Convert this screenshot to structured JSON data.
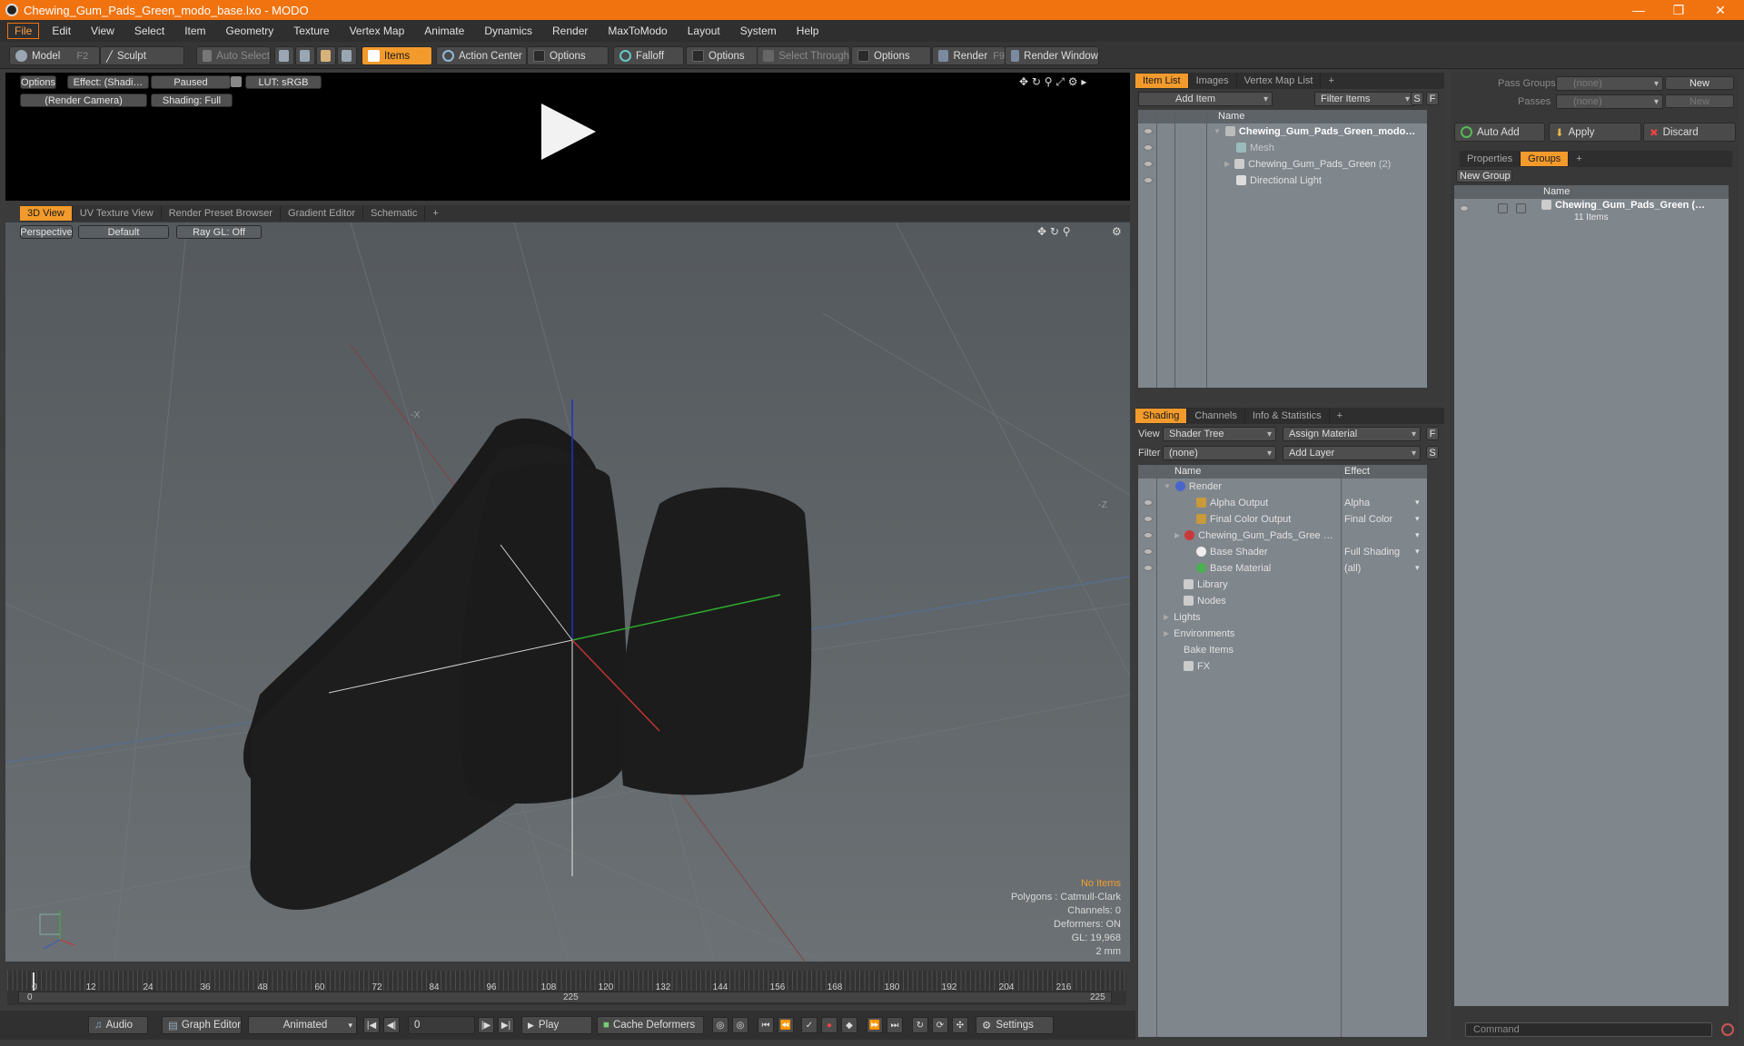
{
  "window": {
    "title": "Chewing_Gum_Pads_Green_modo_base.lxo - MODO"
  },
  "menu": [
    "File",
    "Edit",
    "View",
    "Select",
    "Item",
    "Geometry",
    "Texture",
    "Vertex Map",
    "Animate",
    "Dynamics",
    "Render",
    "MaxToModo",
    "Layout",
    "System",
    "Help"
  ],
  "toolbar": {
    "model": "Model",
    "model_key": "F2",
    "sculpt": "Sculpt",
    "auto_select": "Auto Select",
    "items": "Items",
    "action_center": "Action Center",
    "options1": "Options",
    "falloff": "Falloff",
    "options2": "Options",
    "select_through": "Select Through",
    "options3": "Options",
    "render": "Render",
    "render_key": "F9",
    "render_window": "Render Window"
  },
  "preview": {
    "options": "Options",
    "effect": "Effect: (Shadi…",
    "paused": "Paused",
    "lut": "LUT: sRGB",
    "camera": "(Render Camera)",
    "shading": "Shading: Full"
  },
  "viewport_tabs": [
    "3D View",
    "UV Texture View",
    "Render Preset Browser",
    "Gradient Editor",
    "Schematic"
  ],
  "viewport": {
    "projection": "Perspective",
    "style": "Default",
    "raygl": "Ray GL: Off",
    "axis_neg_x": "-X",
    "axis_neg_z": "-Z",
    "status": [
      "No Items",
      "Polygons : Catmull-Clark",
      "Channels: 0",
      "Deformers: ON",
      "GL: 19,968",
      "2 mm"
    ]
  },
  "timeline": {
    "ticks": [
      "0",
      "12",
      "24",
      "36",
      "48",
      "60",
      "72",
      "84",
      "96",
      "108",
      "120",
      "132",
      "144",
      "156",
      "168",
      "180",
      "192",
      "204",
      "216"
    ],
    "range_start": "0",
    "range_mid": "225",
    "range_end": "225"
  },
  "bottom": {
    "audio": "Audio",
    "graph_editor": "Graph Editor",
    "animated": "Animated",
    "frame": "0",
    "play": "Play",
    "cache_deformers": "Cache Deformers",
    "settings": "Settings",
    "command_placeholder": "Command"
  },
  "item_list": {
    "tabs": [
      "Item List",
      "Images",
      "Vertex Map List"
    ],
    "add_item": "Add Item",
    "filter_items": "Filter Items",
    "s": "S",
    "f": "F",
    "col_name": "Name",
    "rows": [
      {
        "label": "Chewing_Gum_Pads_Green_modo…"
      },
      {
        "label": "Mesh"
      },
      {
        "label": "Chewing_Gum_Pads_Green",
        "count": "(2)"
      },
      {
        "label": "Directional Light"
      }
    ]
  },
  "shading": {
    "tabs": [
      "Shading",
      "Channels",
      "Info & Statistics"
    ],
    "view_label": "View",
    "view_value": "Shader Tree",
    "assign_material": "Assign Material",
    "filter_label": "Filter",
    "filter_value": "(none)",
    "add_layer": "Add Layer",
    "f": "F",
    "s": "S",
    "col_name": "Name",
    "col_effect": "Effect",
    "rows": [
      {
        "label": "Render",
        "effect": ""
      },
      {
        "label": "Alpha Output",
        "effect": "Alpha"
      },
      {
        "label": "Final Color Output",
        "effect": "Final Color"
      },
      {
        "label": "Chewing_Gum_Pads_Gree …",
        "effect": ""
      },
      {
        "label": "Base Shader",
        "effect": "Full Shading"
      },
      {
        "label": "Base Material",
        "effect": "(all)"
      },
      {
        "label": "Library",
        "effect": ""
      },
      {
        "label": "Nodes",
        "effect": ""
      },
      {
        "label": "Lights",
        "effect": ""
      },
      {
        "label": "Environments",
        "effect": ""
      },
      {
        "label": "Bake Items",
        "effect": ""
      },
      {
        "label": "FX",
        "effect": ""
      }
    ]
  },
  "groups": {
    "pass_groups_label": "Pass Groups",
    "pass_groups_value": "(none)",
    "new": "New",
    "passes_label": "Passes",
    "passes_value": "(none)",
    "new2": "New",
    "auto_add": "Auto Add",
    "apply": "Apply",
    "discard": "Discard",
    "tabs": [
      "Properties",
      "Groups"
    ],
    "new_group": "New Group",
    "col_name": "Name",
    "group_name": "Chewing_Gum_Pads_Green (…",
    "group_items": "11 Items"
  },
  "colors": {
    "accent": "#f29a2c",
    "titlebar": "#f07310"
  }
}
